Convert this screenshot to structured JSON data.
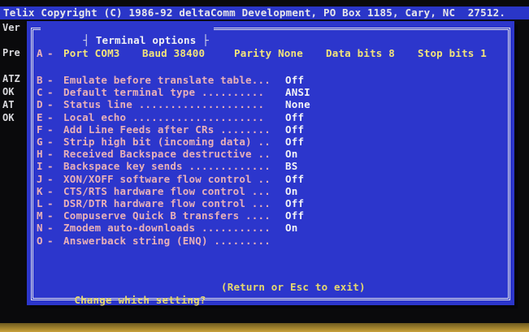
{
  "title_bar": "Telix Copyright (C) 1986-92 deltaComm Development, PO Box 1185, Cary, NC  27512.",
  "background_fragments": [
    "Ver",
    "Pre",
    "ATZ",
    "OK",
    "AT",
    "OK"
  ],
  "dialog": {
    "title": "Terminal options",
    "port_line": {
      "key": "A",
      "port": "Port COM3",
      "baud": "Baud 38400",
      "parity": "Parity None",
      "data_bits": "Data bits 8",
      "stop_bits": "Stop bits 1"
    },
    "options": [
      {
        "key": "B",
        "label": "Emulate before translate table...",
        "value": "Off"
      },
      {
        "key": "C",
        "label": "Default terminal type ..........",
        "value": "ANSI"
      },
      {
        "key": "D",
        "label": "Status line ....................",
        "value": "None"
      },
      {
        "key": "E",
        "label": "Local echo .....................",
        "value": "Off"
      },
      {
        "key": "F",
        "label": "Add Line Feeds after CRs ........",
        "value": "Off"
      },
      {
        "key": "G",
        "label": "Strip high bit (incoming data) ..",
        "value": "Off"
      },
      {
        "key": "H",
        "label": "Received Backspace destructive ..",
        "value": "On"
      },
      {
        "key": "I",
        "label": "Backspace key sends .............",
        "value": "BS"
      },
      {
        "key": "J",
        "label": "XON/XOFF software flow control ..",
        "value": "Off"
      },
      {
        "key": "K",
        "label": "CTS/RTS hardware flow control ...",
        "value": "On"
      },
      {
        "key": "L",
        "label": "DSR/DTR hardware flow control ...",
        "value": "Off"
      },
      {
        "key": "M",
        "label": "Compuserve Quick B transfers ....",
        "value": "Off"
      },
      {
        "key": "N",
        "label": "Zmodem auto-downloads ...........",
        "value": "On"
      },
      {
        "key": "O",
        "label": "Answerback string (ENQ) .........",
        "value": ""
      }
    ],
    "prompt": "Change which setting?",
    "hint": "(Return or Esc to exit)"
  }
}
